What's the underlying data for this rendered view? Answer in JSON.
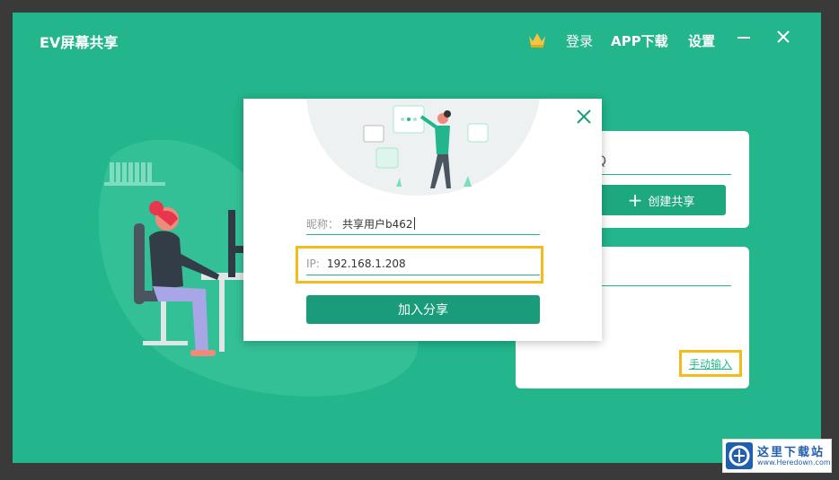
{
  "app": {
    "title": "EV屏幕共享"
  },
  "header": {
    "login": "登录",
    "app_download": "APP下载",
    "settings": "设置"
  },
  "create_card": {
    "partial_text": "Q",
    "create_button": "创建共享"
  },
  "join_card": {
    "manual_input": "手动输入"
  },
  "dialog": {
    "nickname_label": "昵称：",
    "nickname_value": "共享用户b462",
    "ip_label": "IP:",
    "ip_value": "192.168.1.208",
    "join_button": "加入分享"
  },
  "watermark": {
    "title": "这里下载站",
    "url": "www.Heredown.com"
  },
  "colors": {
    "brand_green": "#23b58c",
    "highlight": "#f3bc1c"
  },
  "icons": [
    "crown-icon",
    "minimize-icon",
    "close-icon",
    "plus-icon",
    "dialog-close-icon"
  ]
}
